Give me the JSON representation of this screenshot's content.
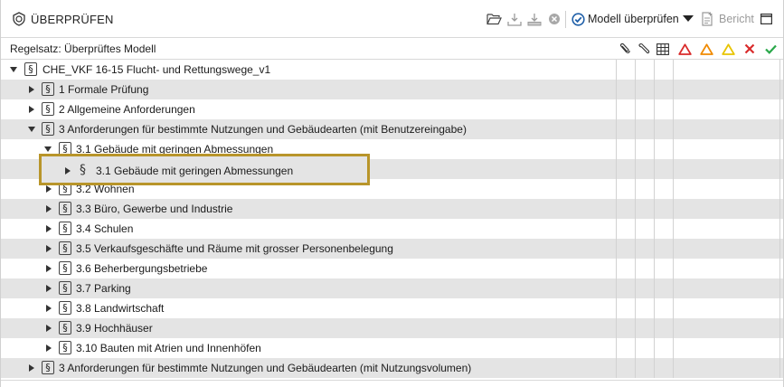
{
  "panel": {
    "title": "ÜBERPRÜFEN",
    "title_icon": "check-shield-icon"
  },
  "toolbar": {
    "open_icon": "folder-open-icon",
    "import_icon": "import-tray-icon",
    "export_icon": "export-tray-icon",
    "clear_icon": "clear-circle-icon",
    "check_model_icon": "check-circle-icon",
    "check_model_label": "Modell überprüfen",
    "dropdown_icon": "triangle-down-icon",
    "report_icon": "report-add-icon",
    "report_label": "Bericht",
    "maximize_icon": "window-maximize-icon"
  },
  "column_header": {
    "ruleset_label": "Regelsatz: Überprüftes Modell",
    "columns": [
      {
        "icon": "paperclip-icon"
      },
      {
        "icon": "wrench-icon"
      },
      {
        "icon": "table-icon"
      },
      {
        "icon": "error-triangle-icon",
        "color": "#d92b2b"
      },
      {
        "icon": "warning-triangle-icon",
        "color": "#f08a00"
      },
      {
        "icon": "info-triangle-icon",
        "color": "#e8c400"
      },
      {
        "icon": "cross-icon",
        "color": "#d92b2b"
      },
      {
        "icon": "check-icon",
        "color": "#2aa84a"
      }
    ]
  },
  "tree": {
    "rows": [
      {
        "label": "CHE_VKF 16-15 Flucht- und Rettungswege_v1",
        "expanded": true
      },
      {
        "label": "1 Formale Prüfung",
        "expanded": false
      },
      {
        "label": "2  Allgemeine Anforderungen",
        "expanded": false
      },
      {
        "label": "3  Anforderungen für bestimmte Nutzungen und Gebäudearten (mit Benutzereingabe)",
        "expanded": true
      },
      {
        "label": "3.1  Gebäude mit geringen Abmessungen",
        "expanded": true
      },
      {
        "label": "3.2  Wohnen",
        "expanded": false
      },
      {
        "label": "3.3  Büro, Gewerbe und Industrie",
        "expanded": false
      },
      {
        "label": "3.4  Schulen",
        "expanded": false
      },
      {
        "label": "3.5  Verkaufsgeschäfte und Räume mit grosser Personenbelegung",
        "expanded": false
      },
      {
        "label": "3.6 Beherbergungsbetriebe",
        "expanded": false
      },
      {
        "label": "3.7 Parking",
        "expanded": false
      },
      {
        "label": "3.8 Landwirtschaft",
        "expanded": false
      },
      {
        "label": "3.9 Hochhäuser",
        "expanded": false
      },
      {
        "label": "3.10 Bauten mit Atrien und Innenhöfen",
        "expanded": false
      },
      {
        "label": "3  Anforderungen für bestimmte Nutzungen und Gebäudearten (mit Nutzungsvolumen)",
        "expanded": false
      }
    ],
    "drag_item": {
      "symbol": "§",
      "label": "3.1 Gebäude mit geringen Abmessungen"
    },
    "section_symbol": "§"
  },
  "colors": {
    "highlight_border": "#b8952a",
    "row_shade": "#e4e4e4",
    "check_blue": "#1f5fa8"
  }
}
